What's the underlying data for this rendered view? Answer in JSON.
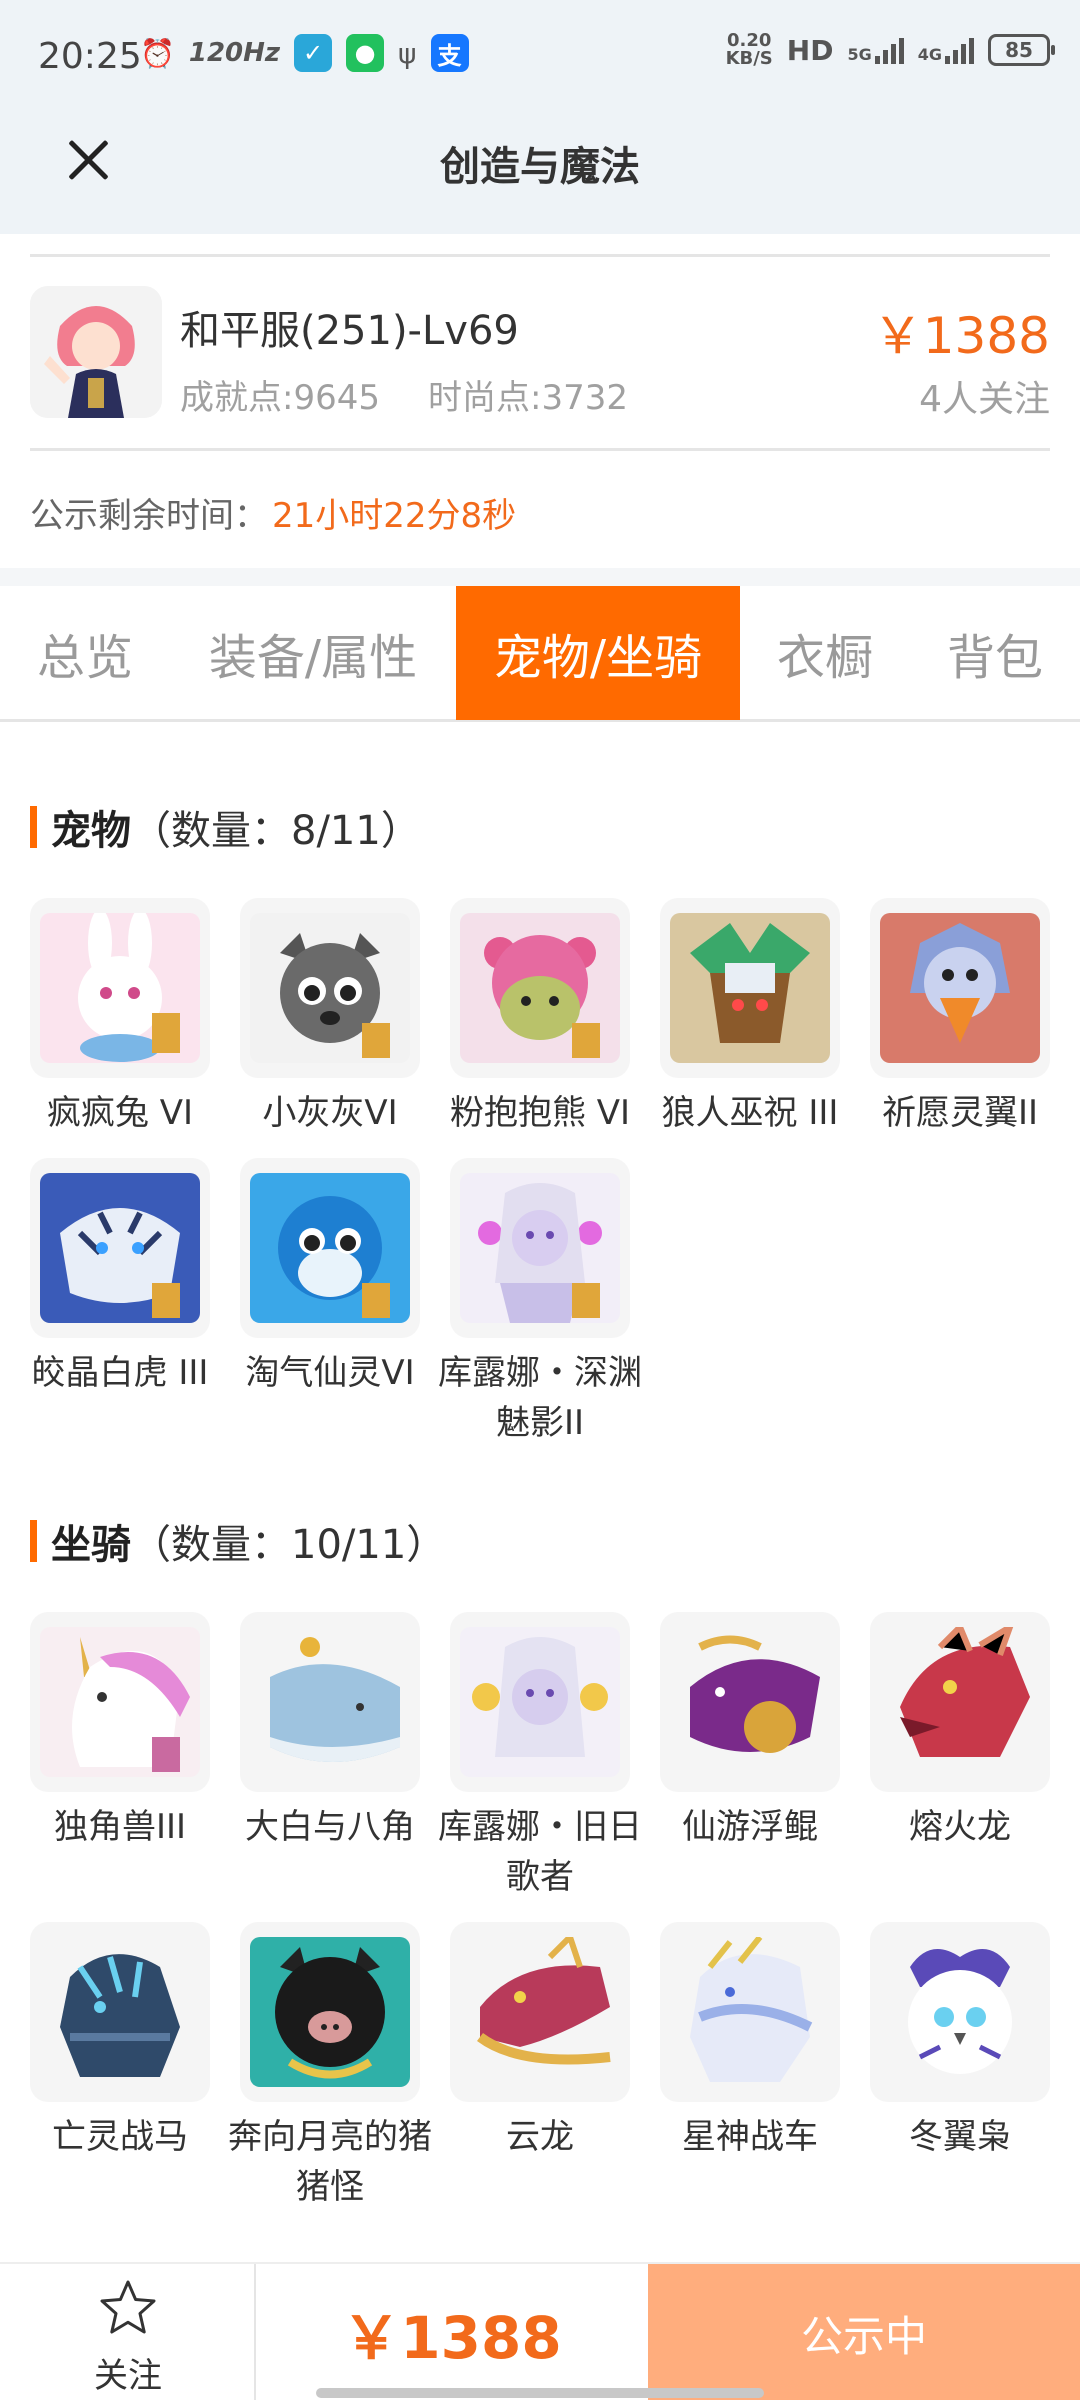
{
  "status_bar": {
    "time": "20:25",
    "refresh": "120Hz",
    "net_speed_value": "0.20",
    "net_speed_unit": "KB/S",
    "hd": "HD",
    "net5g": "5G",
    "net4g": "4G",
    "battery": "85"
  },
  "header": {
    "title": "创造与魔法"
  },
  "listing": {
    "server": "和平服(251)-Lv69",
    "achievement": "成就点:9645",
    "fashion": "时尚点:3732",
    "price": "￥1388",
    "followers": "4人关注",
    "notice_label": "公示剩余时间：",
    "notice_time": "21小时22分8秒"
  },
  "tabs": [
    "总览",
    "装备/属性",
    "宠物/坐骑",
    "衣橱",
    "背包"
  ],
  "active_tab": "宠物/坐骑",
  "pets": {
    "title": "宠物",
    "count": "（数量：8/11）",
    "items": [
      "疯疯兔 VI",
      "小灰灰VI",
      "粉抱抱熊 VI",
      "狼人巫祝 III",
      "祈愿灵翼II",
      "皎晶白虎 III",
      "淘气仙灵VI",
      "库露娜・深渊魅影II"
    ]
  },
  "mounts": {
    "title": "坐骑",
    "count": "（数量：10/11）",
    "items": [
      "独角兽III",
      "大白与八角",
      "库露娜・旧日歌者",
      "仙游浮鲲",
      "熔火龙",
      "亡灵战马",
      "奔向月亮的猪猪怪",
      "云龙",
      "星神战车",
      "冬翼枭"
    ]
  },
  "bottom": {
    "follow_label": "关注",
    "price": "￥1388",
    "status_label": "公示中"
  },
  "colors": {
    "accent": "#ff6a00",
    "price": "#f26a1b",
    "status_button": "#ffad7d"
  }
}
